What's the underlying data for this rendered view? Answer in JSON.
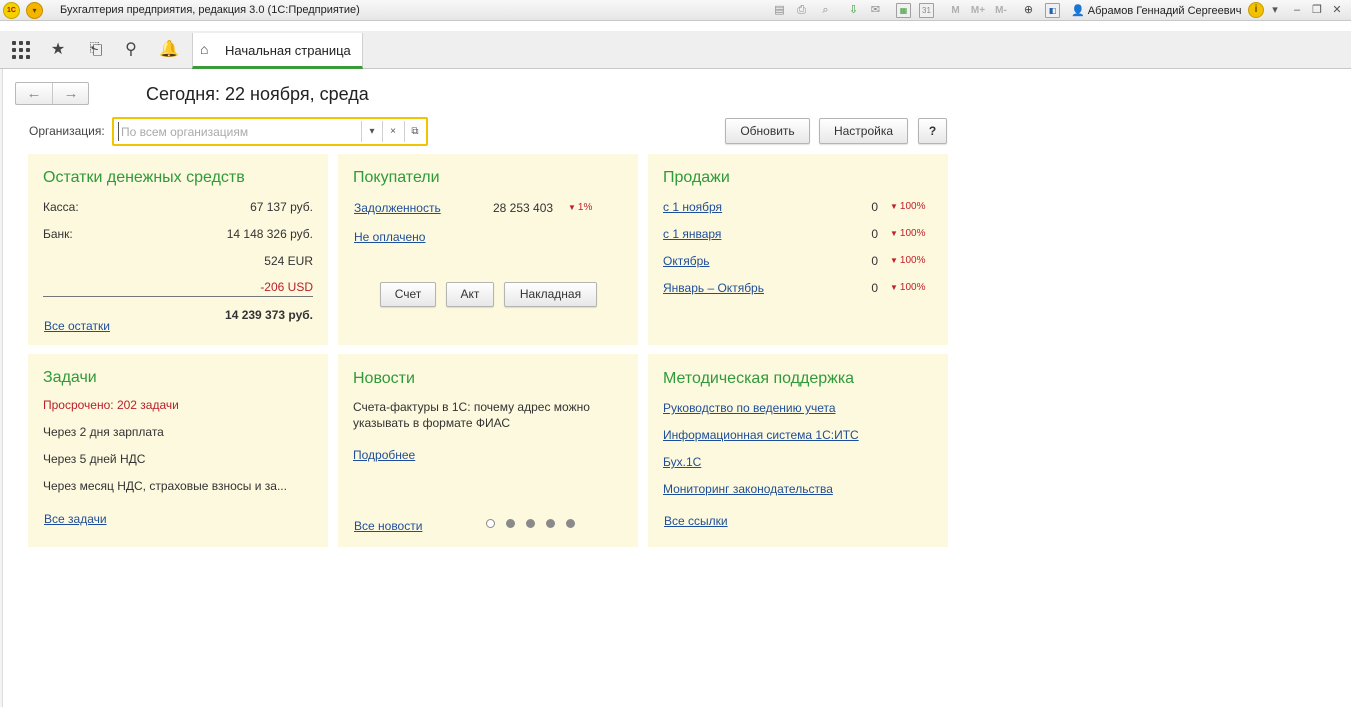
{
  "window": {
    "title": "Бухгалтерия предприятия, редакция 3.0  (1С:Предприятие)",
    "logo_text": "1С",
    "user": "Абрамов Геннадий Сергеевич",
    "toolbar_icons": [
      "save-icon",
      "print-icon",
      "print-preview-icon",
      "load-icon",
      "save-file-icon",
      "calculator-icon",
      "calendar-icon",
      "m-icon",
      "m-plus-icon",
      "m-minus-icon",
      "zoom-icon",
      "panel-icon"
    ],
    "memory_labels": {
      "m": "M",
      "m_plus": "M+",
      "m_minus": "M-"
    },
    "calendar_day": "31"
  },
  "navbar": {
    "tab_label": "Начальная страница"
  },
  "header": {
    "today": "Сегодня: 22 ноября, среда",
    "org_label": "Организация:",
    "org_placeholder": "По всем организациям",
    "refresh_label": "Обновить",
    "settings_label": "Настройка",
    "help_label": "?"
  },
  "cash": {
    "title": "Остатки денежных средств",
    "kassa_label": "Касса:",
    "kassa_value": "67 137 руб.",
    "bank_label": "Банк:",
    "bank_value": "14 148 326 руб.",
    "eur_value": "524 EUR",
    "usd_value": "-206 USD",
    "total_value": "14 239 373 руб.",
    "all_link": "Все остатки"
  },
  "buyers": {
    "title": "Покупатели",
    "debt_link": "Задолженность",
    "debt_value": "28 253 403",
    "debt_change": "1%",
    "unpaid_link": "Не оплачено",
    "btn_invoice": "Счет",
    "btn_act": "Акт",
    "btn_waybill": "Накладная"
  },
  "sales": {
    "title": "Продажи",
    "rows": [
      {
        "label": "с 1 ноября",
        "value": "0",
        "change": "100%"
      },
      {
        "label": "с 1 января",
        "value": "0",
        "change": "100%"
      },
      {
        "label": "Октябрь",
        "value": "0",
        "change": "100%"
      },
      {
        "label": "Январь – Октябрь",
        "value": "0",
        "change": "100%"
      }
    ]
  },
  "tasks": {
    "title": "Задачи",
    "overdue": "Просрочено: 202 задачи",
    "items": [
      "Через 2 дня зарплата",
      "Через 5 дней НДС",
      "Через месяц НДС, страховые взносы и за..."
    ],
    "all_link": "Все задачи"
  },
  "news": {
    "title": "Новости",
    "line1": "Счета-фактуры в 1С: почему адрес можно",
    "line2": "указывать в формате ФИАС",
    "more_link": "Подробнее",
    "all_link": "Все новости",
    "page_count": 5,
    "active_page": 1
  },
  "support": {
    "title": "Методическая поддержка",
    "links": [
      "Руководство по ведению учета",
      "Информационная система 1С:ИТС",
      "Бух.1С",
      "Мониторинг законодательства"
    ],
    "all_link": "Все ссылки"
  },
  "colors": {
    "panel_bg": "#fdf9de",
    "title_green": "#2f9a3a",
    "link_blue": "#1f4e99",
    "alert_red": "#b8202a",
    "focus_yellow": "#f0c400"
  }
}
